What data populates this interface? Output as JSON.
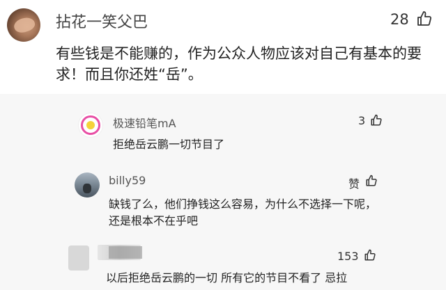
{
  "main_comment": {
    "username": "拈花一笑父巴",
    "text": "有些钱是不能赚的，作为公众人物应该对自己有基本的要求！而且你还姓“岳”。",
    "like_count": "28"
  },
  "replies": [
    {
      "username": "极速铅笔mA",
      "text": "拒绝岳云鹏一切节目了",
      "like_count": "3"
    },
    {
      "username": "billy59",
      "text_line1": "缺钱了么，他们挣钱这么容易，为什么不选择一下呢，",
      "text_line2": "还是根本不在乎吧",
      "like_label": "赞"
    },
    {
      "username": "",
      "text": "以后拒绝岳云鹏的一切 所有它的节目不看了 忌拉",
      "like_count": "153"
    }
  ],
  "colors": {
    "background": "#ffffff",
    "reply_background": "#f7f7f7",
    "text_primary": "#222222",
    "text_secondary": "#555555"
  }
}
